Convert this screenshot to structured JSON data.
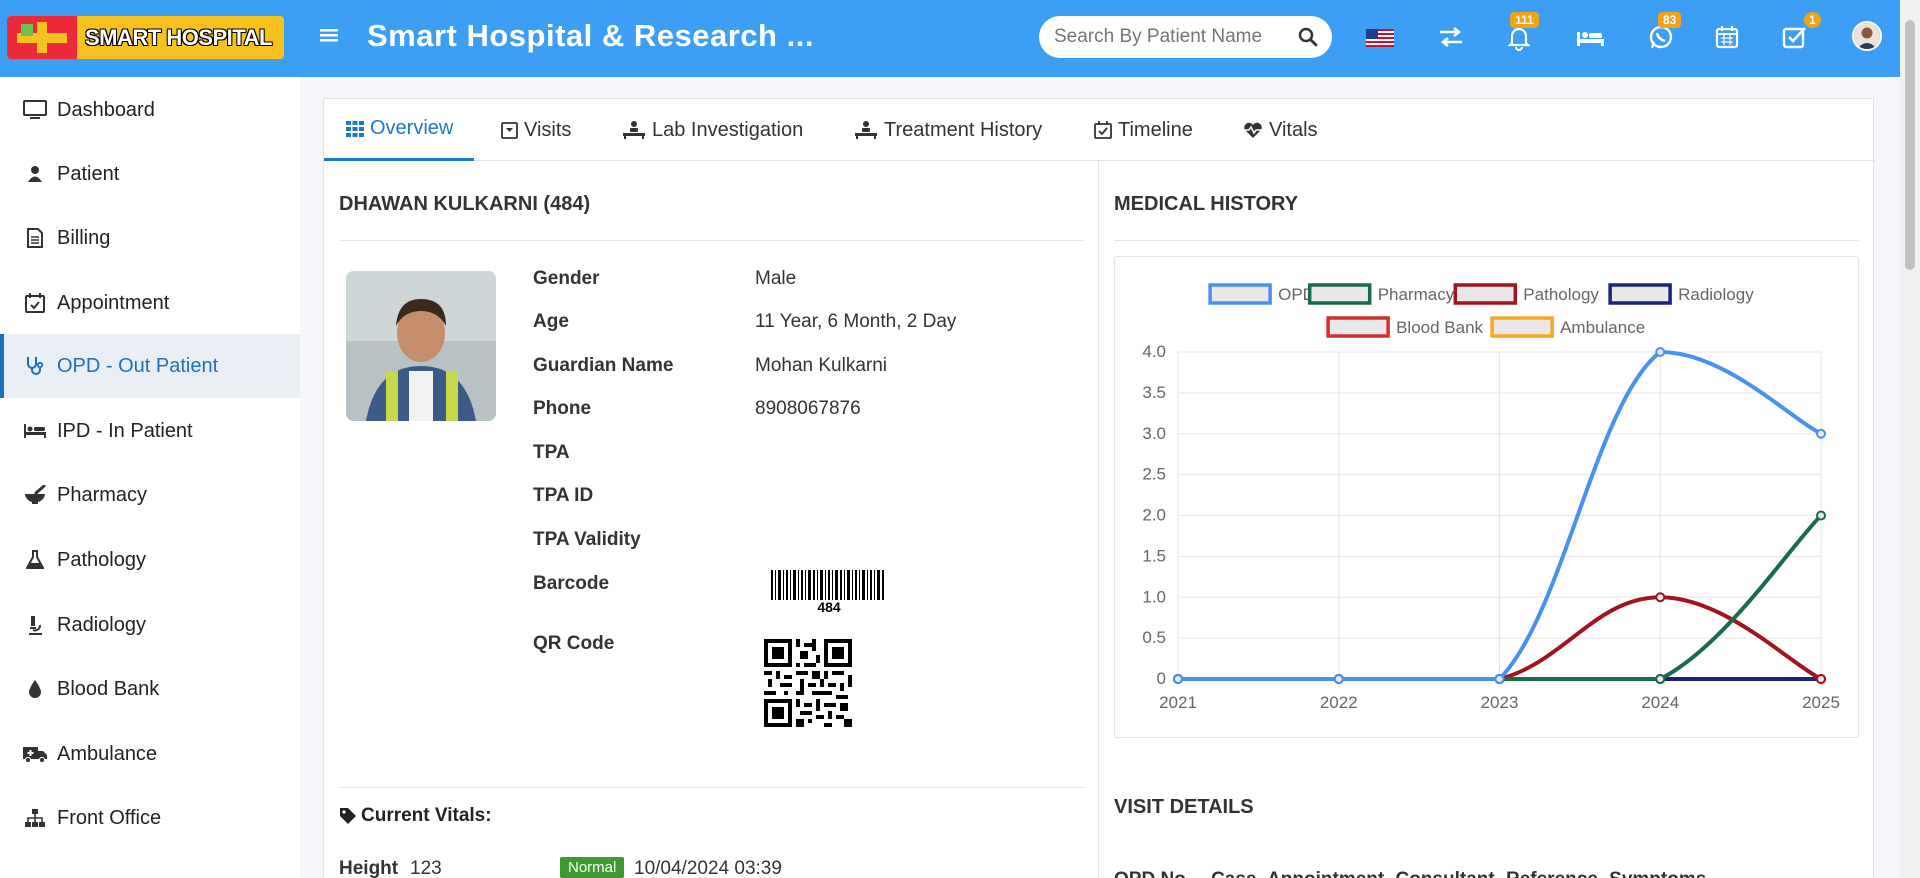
{
  "header": {
    "logo_text": "SMART HOSPITAL",
    "title": "Smart Hospital & Research ...",
    "search_placeholder": "Search By Patient Name",
    "notification_count": "111",
    "whatsapp_count": "83",
    "task_count": "1"
  },
  "sidebar": {
    "items": [
      {
        "label": "Dashboard",
        "icon": "monitor-icon"
      },
      {
        "label": "Patient",
        "icon": "user-icon"
      },
      {
        "label": "Billing",
        "icon": "receipt-icon"
      },
      {
        "label": "Appointment",
        "icon": "calendar-check-icon"
      },
      {
        "label": "OPD - Out Patient",
        "icon": "stethoscope-icon",
        "active": true
      },
      {
        "label": "IPD - In Patient",
        "icon": "bed-icon"
      },
      {
        "label": "Pharmacy",
        "icon": "mortar-pestle-icon"
      },
      {
        "label": "Pathology",
        "icon": "flask-icon"
      },
      {
        "label": "Radiology",
        "icon": "microscope-icon"
      },
      {
        "label": "Blood Bank",
        "icon": "tint-icon"
      },
      {
        "label": "Ambulance",
        "icon": "ambulance-icon"
      },
      {
        "label": "Front Office",
        "icon": "sitemap-icon"
      }
    ]
  },
  "tabs": [
    {
      "label": "Overview",
      "active": true
    },
    {
      "label": "Visits"
    },
    {
      "label": "Lab Investigation"
    },
    {
      "label": "Treatment History"
    },
    {
      "label": "Timeline"
    },
    {
      "label": "Vitals"
    }
  ],
  "patient": {
    "name": "DHAWAN KULKARNI (484)",
    "fields": [
      {
        "label": "Gender",
        "value": "Male"
      },
      {
        "label": "Age",
        "value": "11 Year, 6 Month, 2 Day"
      },
      {
        "label": "Guardian Name",
        "value": "Mohan Kulkarni"
      },
      {
        "label": "Phone",
        "value": "8908067876"
      },
      {
        "label": "TPA",
        "value": ""
      },
      {
        "label": "TPA ID",
        "value": ""
      },
      {
        "label": "TPA Validity",
        "value": ""
      },
      {
        "label": "Barcode",
        "value": ""
      },
      {
        "label": "QR Code",
        "value": ""
      }
    ],
    "barcode_number": "484"
  },
  "vitals": {
    "title": "Current Vitals:",
    "rows": [
      {
        "name": "Height",
        "value": "123",
        "status": "Normal",
        "date": "10/04/2024 03:39"
      }
    ]
  },
  "medical_history": {
    "title": "MEDICAL HISTORY"
  },
  "visit_details": {
    "title": "VISIT DETAILS",
    "columns": [
      "OPD No",
      "Case",
      "Appointment",
      "Consultant",
      "Reference",
      "Symptoms"
    ]
  },
  "chart_data": {
    "type": "line",
    "x": [
      "2021",
      "2022",
      "2023",
      "2024",
      "2025"
    ],
    "ylim": [
      0,
      4.0
    ],
    "yticks": [
      "0",
      "0.5",
      "1.0",
      "1.5",
      "2.0",
      "2.5",
      "3.0",
      "3.5",
      "4.0"
    ],
    "legend_placement": "top",
    "grid": true,
    "series": [
      {
        "name": "OPD",
        "color": "#4a90f0",
        "values": [
          0,
          0,
          0,
          4,
          3
        ]
      },
      {
        "name": "Pharmacy",
        "color": "#1a6b4a",
        "values": [
          0,
          0,
          0,
          0,
          2
        ]
      },
      {
        "name": "Pathology",
        "color": "#a0141e",
        "values": [
          0,
          0,
          0,
          1,
          0
        ]
      },
      {
        "name": "Radiology",
        "color": "#1a237e",
        "values": [
          0,
          0,
          0,
          0,
          0
        ]
      },
      {
        "name": "Blood Bank",
        "color": "#d32f2f",
        "values": [
          0,
          0,
          0,
          0,
          0
        ]
      },
      {
        "name": "Ambulance",
        "color": "#f5a623",
        "values": [
          0,
          0,
          0,
          0,
          0
        ]
      }
    ]
  }
}
